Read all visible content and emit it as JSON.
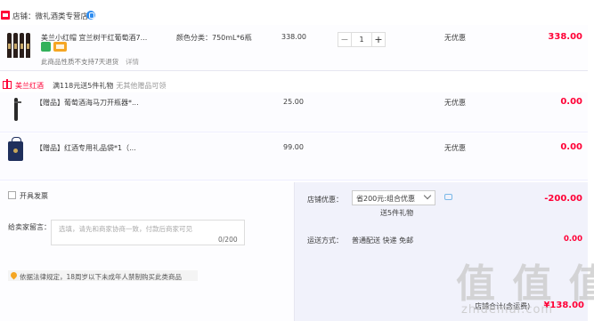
{
  "shop": {
    "label": "店铺：",
    "name": "微礼酒类专营店"
  },
  "item": {
    "title": "美兰小红帽 宜兰树干红葡萄酒7...",
    "sku": "颜色分类：750mL*6瓶",
    "notice": "此商品性质不支持7天退货",
    "notice_link": "详情",
    "unit_price": "338.00",
    "quantity": "1",
    "minus": "−",
    "plus": "+",
    "discount": "无优惠",
    "total": "338.00"
  },
  "promotion": {
    "shop": "美兰红酒",
    "desc": "满118元送5件礼物",
    "desc_sub": "无其他赠品可领"
  },
  "gifts": [
    {
      "title": "【赠品】葡萄酒海马刀开瓶器*...",
      "price": "25.00",
      "discount": "无优惠",
      "total": "0.00"
    },
    {
      "title": "【赠品】红酒专用礼品袋*1（...",
      "price": "99.00",
      "discount": "无优惠",
      "total": "0.00"
    }
  ],
  "invoice": {
    "label": "开具发票"
  },
  "message": {
    "label": "给卖家留言：",
    "placeholder": "选填，请先和商家协商一致，付款后商家可见",
    "counter": "0/200"
  },
  "law": {
    "text": "依据法律规定，18周岁以下未成年人禁制购买此类商品"
  },
  "coupon": {
    "label": "店铺优惠：",
    "value": "省200元:组合优惠",
    "sub": "送5件礼物",
    "amount": "-200.00"
  },
  "shipping": {
    "label": "运送方式：",
    "value": "普通配送 快递 免邮",
    "amount": "0.00"
  },
  "subtotal": {
    "label": "店铺合计(含运费)",
    "amount": "¥138.00"
  },
  "watermark": {
    "text": "值 值 值",
    "url": "zhidemai.com"
  },
  "colors": {
    "accent": "#ff0036",
    "badge_green": "#33b15b",
    "badge_orange": "#f5a623"
  }
}
